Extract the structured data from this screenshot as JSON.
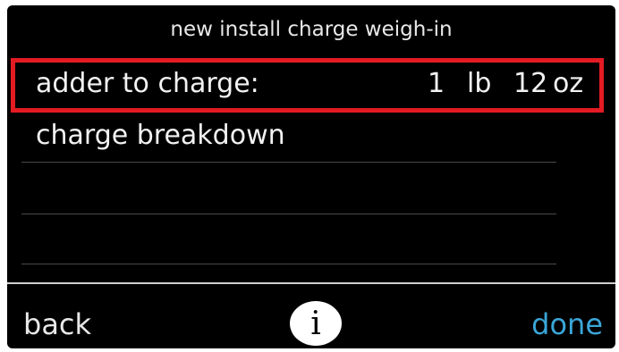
{
  "title": "new install charge weigh-in",
  "rows": [
    {
      "label": "adder to charge:",
      "value_lb": "1",
      "unit_lb": "lb",
      "value_oz": "12",
      "unit_oz": "oz",
      "highlighted": true
    },
    {
      "label": "charge breakdown"
    }
  ],
  "footer": {
    "back_label": "back",
    "info_label": "i",
    "done_label": "done"
  },
  "colors": {
    "highlight": "#e31b23",
    "done": "#3aa6d8",
    "background": "#000000"
  }
}
